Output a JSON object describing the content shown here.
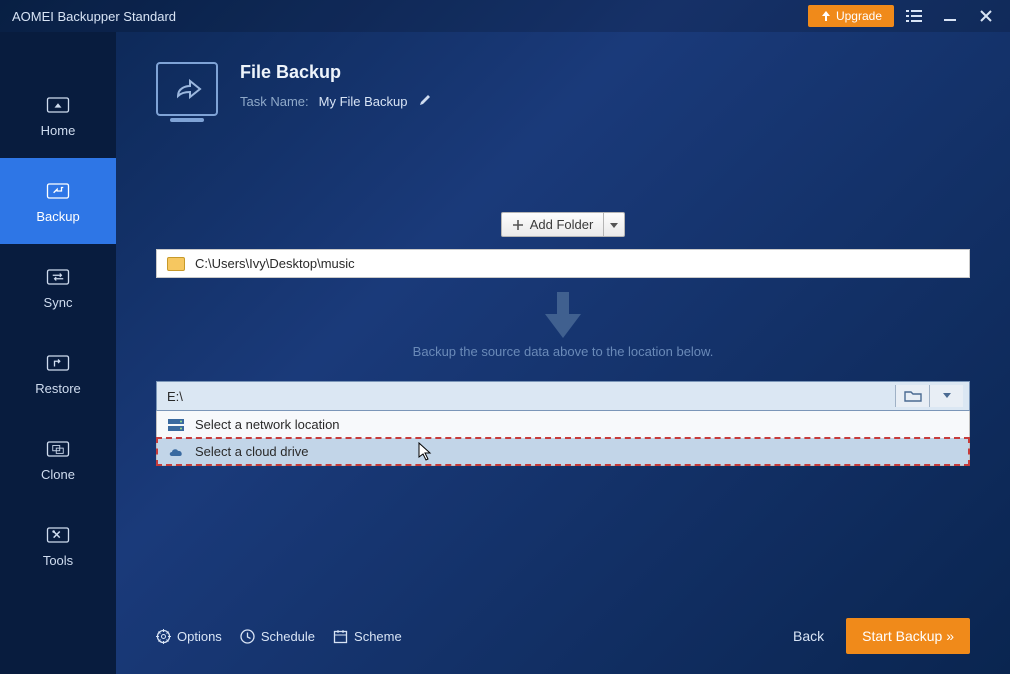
{
  "titlebar": {
    "app_title": "AOMEI Backupper Standard",
    "upgrade_label": "Upgrade"
  },
  "sidebar": {
    "items": [
      {
        "label": "Home",
        "icon": "home-icon"
      },
      {
        "label": "Backup",
        "icon": "backup-icon"
      },
      {
        "label": "Sync",
        "icon": "sync-icon"
      },
      {
        "label": "Restore",
        "icon": "restore-icon"
      },
      {
        "label": "Clone",
        "icon": "clone-icon"
      },
      {
        "label": "Tools",
        "icon": "tools-icon"
      }
    ]
  },
  "page": {
    "title": "File Backup",
    "task_label": "Task Name:",
    "task_name": "My File Backup",
    "add_folder_label": "Add Folder",
    "source_path": "C:\\Users\\Ivy\\Desktop\\music",
    "hint": "Backup the source data above to the location below.",
    "dest_path": "E:\\",
    "dropdown": [
      {
        "label": "Select a network location",
        "icon": "network-icon"
      },
      {
        "label": "Select a cloud drive",
        "icon": "cloud-icon"
      }
    ]
  },
  "footer": {
    "options_label": "Options",
    "schedule_label": "Schedule",
    "scheme_label": "Scheme",
    "back_label": "Back",
    "start_label": "Start Backup »"
  },
  "colors": {
    "accent_orange": "#f08a1a",
    "accent_blue": "#2e76e6"
  }
}
